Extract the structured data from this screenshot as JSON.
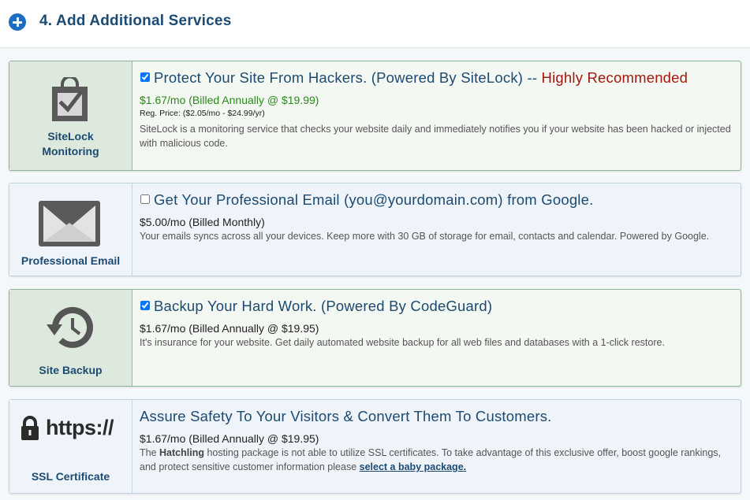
{
  "section": {
    "title": "4. Add Additional Services"
  },
  "services": [
    {
      "icon_label_line1": "SiteLock",
      "icon_label_line2": "Monitoring",
      "title": "Protect Your Site From Hackers. (Powered By SiteLock) --",
      "recommended": "Highly Recommended",
      "checked": true,
      "price": "$1.67/mo (Billed Annually @ $19.99)",
      "reg_price": "Reg. Price: ($2.05/mo - $24.99/yr)",
      "description": "SiteLock is a monitoring service that checks your website daily and immediately notifies you if your website has been hacked or injected with malicious code."
    },
    {
      "icon_label": "Professional Email",
      "title": "Get Your Professional Email (you@yourdomain.com) from Google.",
      "checked": false,
      "price": "$5.00/mo (Billed Monthly)",
      "description": "Your emails syncs across all your devices. Keep more with 30 GB of storage for email, contacts and calendar. Powered by Google."
    },
    {
      "icon_label": "Site Backup",
      "title": "Backup Your Hard Work. (Powered By CodeGuard)",
      "checked": true,
      "price": "$1.67/mo (Billed Annually @ $19.95)",
      "description": "It's insurance for your website. Get daily automated website backup for all web files and databases with a 1-click restore."
    },
    {
      "icon_label": "SSL Certificate",
      "icon_text": "https://",
      "title": "Assure Safety To Your Visitors & Convert Them To Customers.",
      "price": "$1.67/mo (Billed Annually @ $19.95)",
      "description_prefix": "The",
      "package_name": "Hatchling",
      "description_middle": "hosting package is not able to utilize SSL certificates. To take advantage of this exclusive offer, boost google rankings, and protect sensitive customer information please",
      "link_text": "select a baby package."
    }
  ],
  "colors": {
    "accent": "#1b6ec2",
    "heading": "#1d4a72",
    "recommended": "#a3170e",
    "sale_price": "#2a8a1b"
  }
}
